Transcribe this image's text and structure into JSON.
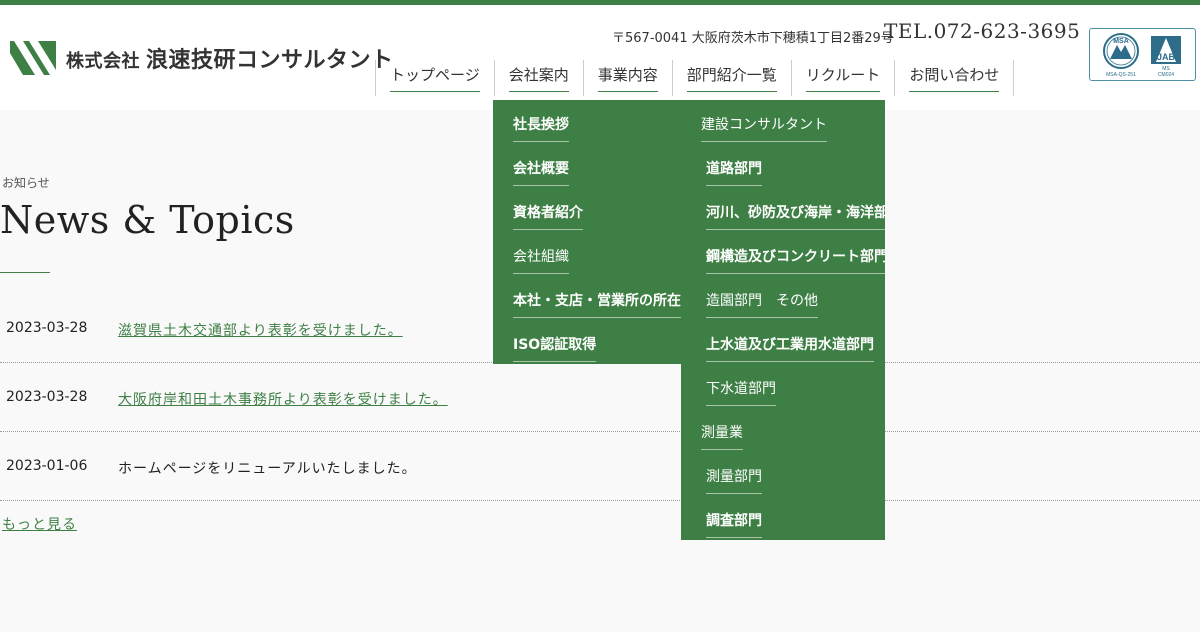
{
  "company": {
    "name_prefix": "株式会社",
    "name": "浪速技研コンサルタント",
    "address": "〒567-0041 大阪府茨木市下穂積1丁目2番29号",
    "tel": "TEL.072-623-3695",
    "cert_labels": {
      "msa": "MSA",
      "msa_code": "MSA-QS-251",
      "jab": "JAB",
      "jab_ms": "MS",
      "jab_code": "CM024"
    }
  },
  "nav": {
    "items": [
      {
        "label": "トップページ"
      },
      {
        "label": "会社案内"
      },
      {
        "label": "事業内容"
      },
      {
        "label": "部門紹介一覧"
      },
      {
        "label": "リクルート"
      },
      {
        "label": "お問い合わせ"
      }
    ]
  },
  "submenu_company": {
    "items": [
      {
        "label": "社長挨拶"
      },
      {
        "label": "会社概要"
      },
      {
        "label": "資格者紹介"
      },
      {
        "label": "会社組織"
      },
      {
        "label": "本社・支店・営業所の所在地"
      },
      {
        "label": "ISO認証取得"
      }
    ]
  },
  "submenu_dept": {
    "items": [
      {
        "label": "建設コンサルタント"
      },
      {
        "label": "道路部門"
      },
      {
        "label": "河川、砂防及び海岸・海洋部門"
      },
      {
        "label": "鋼構造及びコンクリート部門"
      },
      {
        "label": "造園部門　その他"
      },
      {
        "label": "上水道及び工業用水道部門"
      },
      {
        "label": "下水道部門"
      },
      {
        "label": "測量業"
      },
      {
        "label": "測量部門"
      },
      {
        "label": "調査部門"
      }
    ]
  },
  "news": {
    "subtitle": "お知らせ",
    "title": "News & Topics",
    "items": [
      {
        "date": "2023-03-28",
        "text": "滋賀県土木交通部より表彰を受けました。"
      },
      {
        "date": "2023-03-28",
        "text": "大阪府岸和田土木事務所より表彰を受けました。"
      },
      {
        "date": "2023-01-06",
        "text": "ホームページをリニューアルいたしました。"
      }
    ],
    "more": "もっと見る"
  },
  "colors": {
    "brand": "#3e7f45",
    "background": "#f9f9f9"
  }
}
